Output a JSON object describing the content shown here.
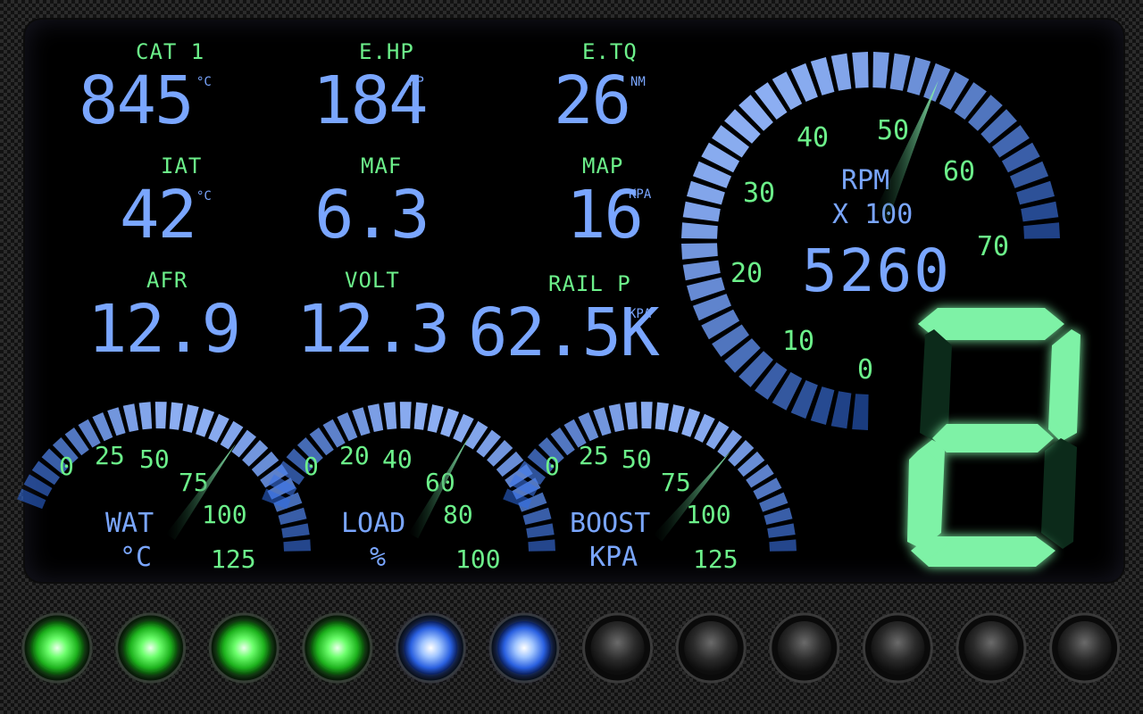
{
  "readouts": [
    {
      "label": "CAT 1",
      "value": "845",
      "unit": "°C"
    },
    {
      "label": "E.HP",
      "value": "184",
      "unit": "HP"
    },
    {
      "label": "E.TQ",
      "value": "26",
      "unit": "NM"
    },
    {
      "label": "IAT",
      "value": "42",
      "unit": "°C"
    },
    {
      "label": "MAF",
      "value": "6.3",
      "unit": ""
    },
    {
      "label": "MAP",
      "value": "16",
      "unit": "KPA"
    },
    {
      "label": "AFR",
      "value": "12.9",
      "unit": ""
    },
    {
      "label": "VOLT",
      "value": "12.3",
      "unit": ""
    },
    {
      "label": "RAIL P",
      "value": "62.5K",
      "unit": "KPA"
    }
  ],
  "rpm_gauge": {
    "name": "RPM",
    "scale_label": "X 100",
    "reading": "5260",
    "ticks": [
      "0",
      "10",
      "20",
      "30",
      "40",
      "50",
      "60",
      "70"
    ],
    "value": 52.6,
    "max": 70
  },
  "small_gauges": [
    {
      "name": "WAT",
      "unit": "°C",
      "ticks": [
        "0",
        "25",
        "50",
        "75",
        "100",
        "125"
      ],
      "value": 82,
      "max": 125
    },
    {
      "name": "LOAD",
      "unit": "%",
      "ticks": [
        "0",
        "20",
        "40",
        "60",
        "80",
        "100"
      ],
      "value": 62,
      "max": 100
    },
    {
      "name": "BOOST",
      "unit": "KPA",
      "ticks": [
        "0",
        "25",
        "50",
        "75",
        "100",
        "125"
      ],
      "value": 86,
      "max": 125
    }
  ],
  "gear": {
    "digit": "2"
  },
  "shift_lights": {
    "total": 12,
    "green_lit": 4,
    "blue_lit": 2
  },
  "colors": {
    "label_green": "#6cf08a",
    "value_blue": "#7aa6ff",
    "gear_green": "#7ef2a6",
    "gear_dim": "#0c2a1a"
  }
}
